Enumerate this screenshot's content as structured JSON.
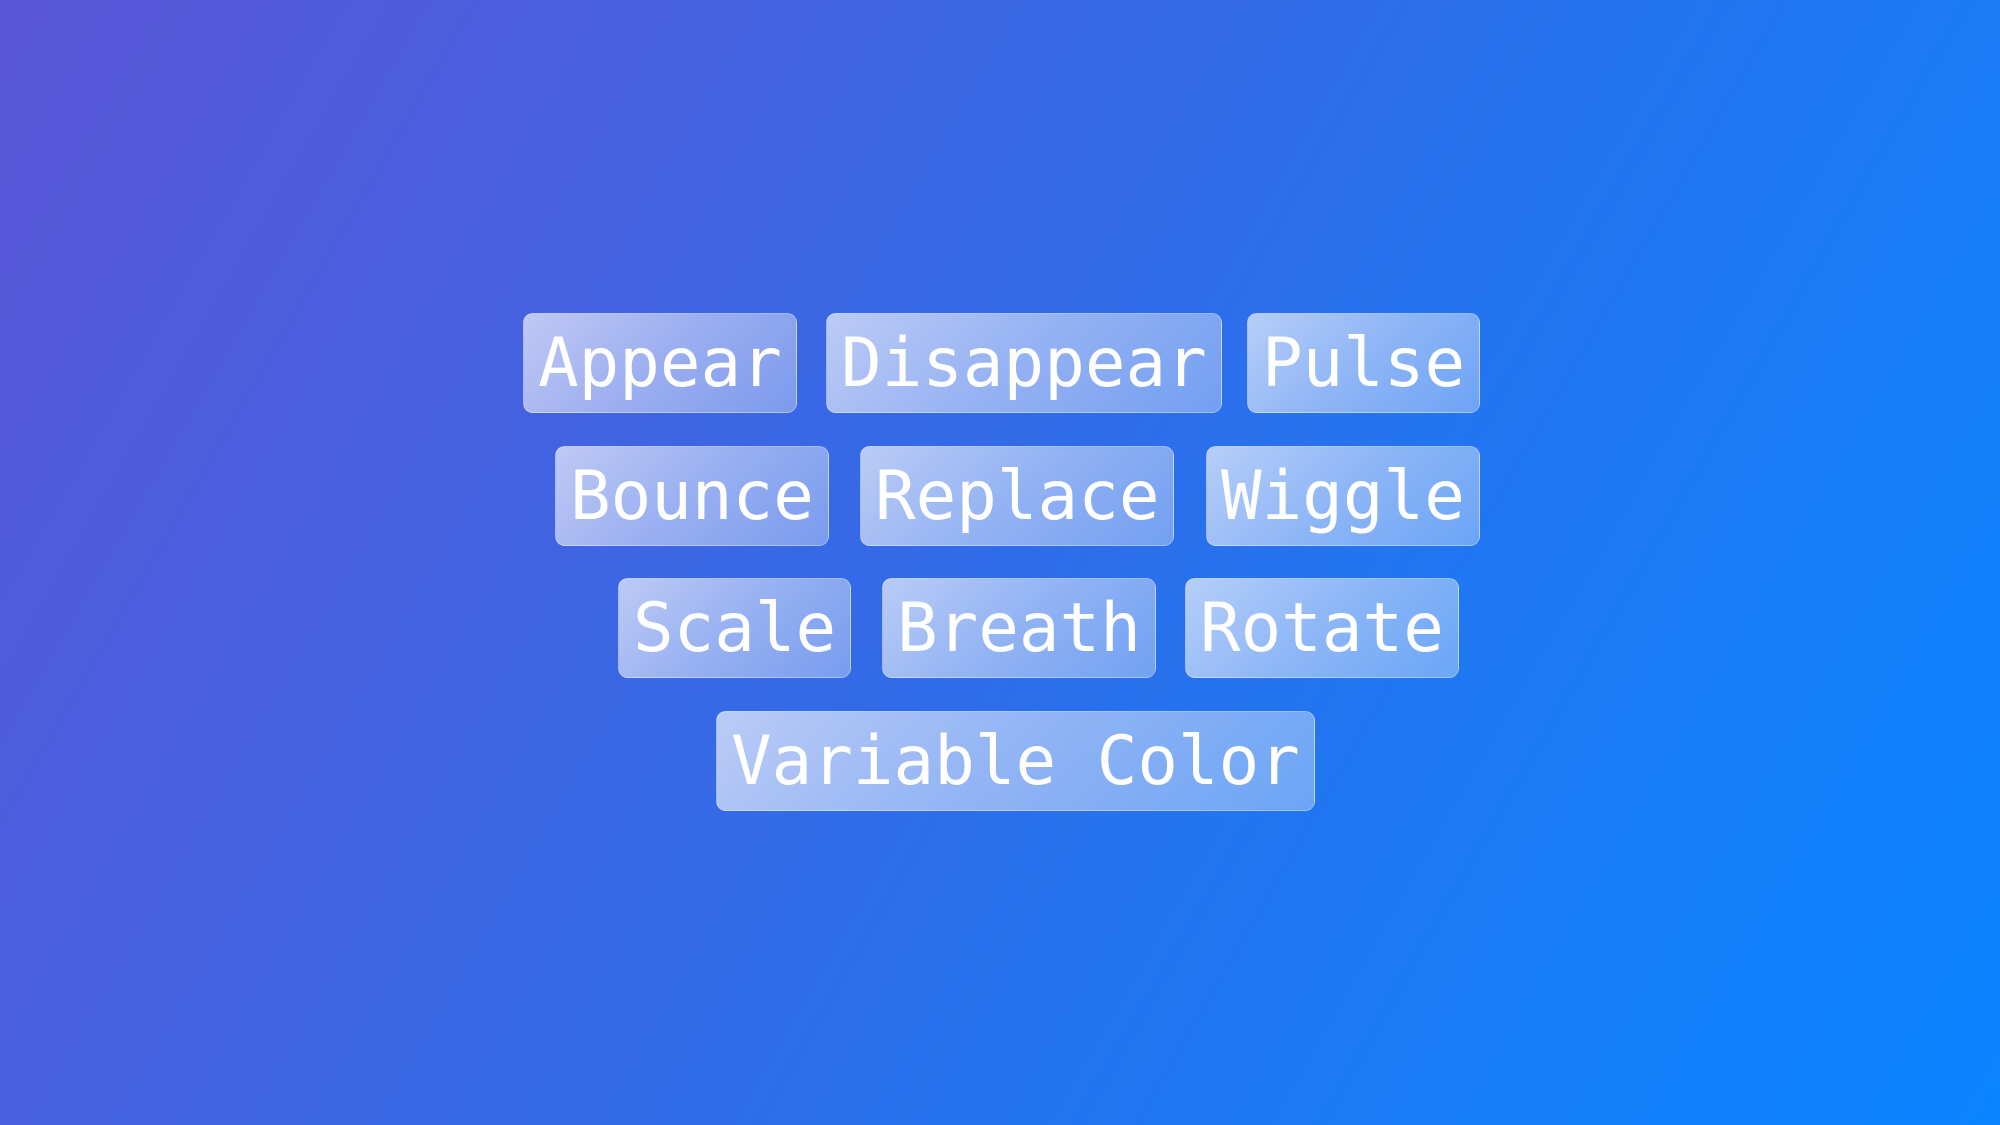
{
  "background": {
    "gradient_start": "#5856D6",
    "gradient_end": "#0A84FF"
  },
  "tags": {
    "rows": [
      [
        "Appear",
        "Disappear",
        "Pulse"
      ],
      [
        "Bounce",
        "Replace",
        "Wiggle"
      ],
      [
        "Scale",
        "Breath",
        "Rotate"
      ],
      [
        "Variable Color"
      ]
    ]
  }
}
